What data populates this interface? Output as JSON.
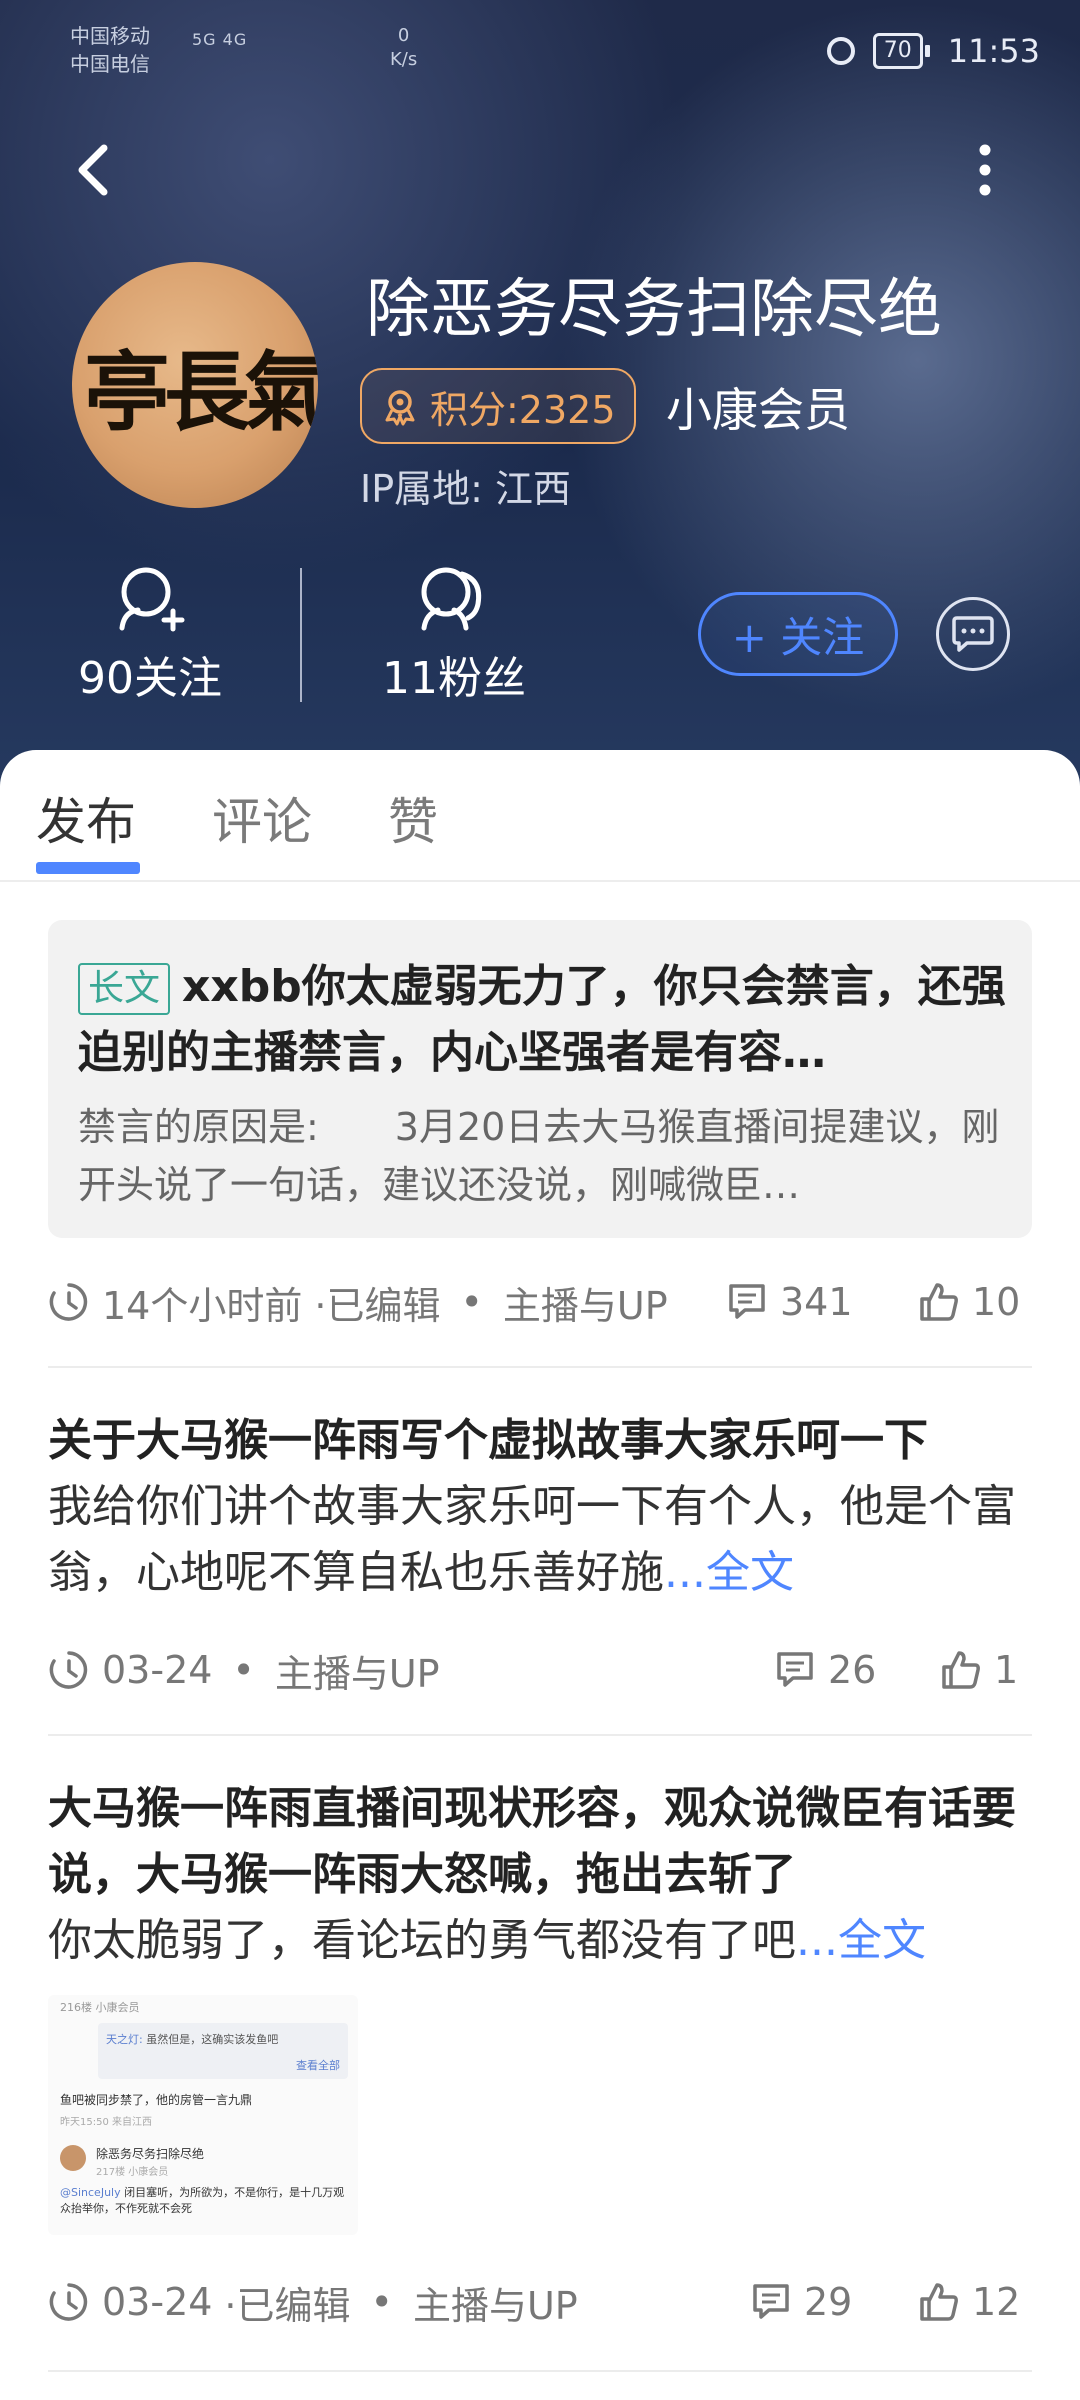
{
  "status_bar": {
    "carrier1": "中国移动",
    "carrier2": "中国电信",
    "signal": "5G 4G",
    "speed_value": "0",
    "speed_unit": "K/s",
    "battery": "70",
    "time": "11:53"
  },
  "profile": {
    "username": "除恶务尽务扫除尽绝",
    "avatar_text": "亭長氣",
    "points_label": "积分:2325",
    "member_level": "小康会员",
    "ip_location": "IP属地: 江西",
    "following": "90关注",
    "followers": "11粉丝",
    "follow_button": "+ 关注"
  },
  "tabs": {
    "items": [
      "发布",
      "评论",
      "赞"
    ],
    "active": "发布"
  },
  "posts": [
    {
      "badge": "长文",
      "title": "xxbb你太虚弱无力了，你只会禁言，还强迫别的主播禁言，内心坚强者是有容…",
      "excerpt": " 禁言的原因是:　　3月20日去大马猴直播间提建议，刚开头说了一句话，建议还没说，刚喊微臣…",
      "time": "14个小时前",
      "edited": "·已编辑",
      "category": "主播与UP",
      "comments": "341",
      "likes": "10"
    },
    {
      "title": "关于大马猴一阵雨写个虚拟故事大家乐呵一下",
      "body": "我给你们讲个故事大家乐呵一下有个人，他是个富翁，心地呢不算自私也乐善好施",
      "more": "...全文",
      "time": "03-24",
      "category": "主播与UP",
      "comments": "26",
      "likes": "1"
    },
    {
      "title": "大马猴一阵雨直播间现状形容，观众说微臣有话要说，大马猴一阵雨大怒喊，拖出去斩了",
      "body": "你太脆弱了，看论坛的勇气都没有了吧",
      "more": "...全文",
      "time": "03-24",
      "edited": "·已编辑",
      "category": "主播与UP",
      "comments": "29",
      "likes": "12",
      "thumbnail": {
        "line1": "216楼 小康会员",
        "quote_user": "天之灯:",
        "quote_text": "虽然但是，这确实该发鱼吧",
        "view_all": "查看全部",
        "line2": "鱼吧被同步禁了，他的房管一言九鼎",
        "line2_meta": "昨天15:50 来自江西",
        "reply_user": "除恶务尽务扫除尽绝",
        "reply_meta": "217楼 小康会员",
        "mention": "@SinceJuly",
        "reply_text": "闭目塞听，为所欲为，不是你行，是十几万观众抬举你，不作死就不会死"
      }
    }
  ],
  "colors": {
    "accent": "#4f86ff",
    "points": "#f0a864",
    "badge": "#3aa795",
    "header_bg": "#1e2b4b"
  }
}
